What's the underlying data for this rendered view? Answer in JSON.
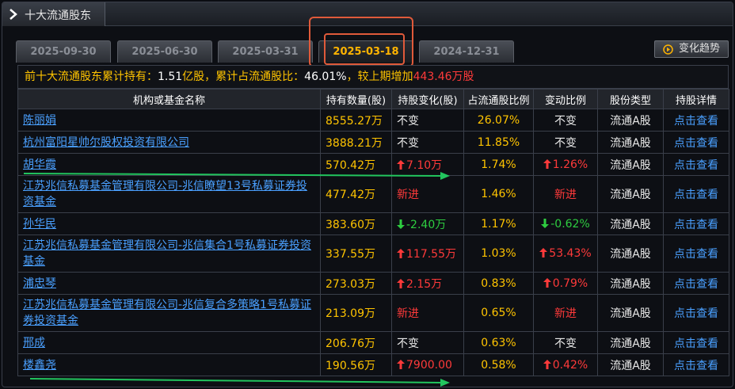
{
  "panel": {
    "title": "十大流通股东"
  },
  "tabs": [
    {
      "label": "2025-09-30",
      "active": false
    },
    {
      "label": "2025-06-30",
      "active": false
    },
    {
      "label": "2025-03-31",
      "active": false
    },
    {
      "label": "2025-03-18",
      "active": true
    },
    {
      "label": "2024-12-31",
      "active": false
    }
  ],
  "trend_button": {
    "label": "变化趋势"
  },
  "summary": {
    "prefix": "前十大流通股东累计持有：",
    "total_holding": "1.51",
    "mid1": "亿股，累计占流通股比：",
    "total_ratio": "46.01%",
    "mid2": "，较上期增加",
    "increase": "443.46万股"
  },
  "table": {
    "headers": [
      "机构或基金名称",
      "持有数量(股)",
      "持股变化(股)",
      "占流通股比例",
      "变动比例",
      "股份类型",
      "持股详情"
    ],
    "rows": [
      {
        "name": "陈丽娟",
        "amount": "8555.27万",
        "change": "不变",
        "change_dir": "same",
        "pct": "26.07%",
        "ratio": "不变",
        "type": "流通A股",
        "detail": "点击查看"
      },
      {
        "name": "杭州富阳星帅尔股权投资有限公司",
        "amount": "3888.21万",
        "change": "不变",
        "change_dir": "same",
        "pct": "11.85%",
        "ratio": "不变",
        "type": "流通A股",
        "detail": "点击查看"
      },
      {
        "name": "胡华霞",
        "amount": "570.42万",
        "change": "7.10万",
        "change_dir": "up",
        "pct": "1.74%",
        "ratio": "1.26%",
        "type": "流通A股",
        "detail": "点击查看"
      },
      {
        "name": "江苏兆信私募基金管理有限公司-兆信瞭望13号私募证券投资基金",
        "amount": "477.42万",
        "change": "新进",
        "change_dir": "new",
        "pct": "1.46%",
        "ratio": "新进",
        "type": "流通A股",
        "detail": "点击查看"
      },
      {
        "name": "孙华民",
        "amount": "383.60万",
        "change": "-2.40万",
        "change_dir": "down",
        "pct": "1.17%",
        "ratio": "-0.62%",
        "type": "流通A股",
        "detail": "点击查看"
      },
      {
        "name": "江苏兆信私募基金管理有限公司-兆信集合1号私募证券投资基金",
        "amount": "337.55万",
        "change": "117.55万",
        "change_dir": "up",
        "pct": "1.03%",
        "ratio": "53.43%",
        "type": "流通A股",
        "detail": "点击查看"
      },
      {
        "name": "浦忠琴",
        "amount": "273.03万",
        "change": "2.15万",
        "change_dir": "up",
        "pct": "0.83%",
        "ratio": "0.79%",
        "type": "流通A股",
        "detail": "点击查看"
      },
      {
        "name": "江苏兆信私募基金管理有限公司-兆信复合多策略1号私募证券投资基金",
        "amount": "213.09万",
        "change": "新进",
        "change_dir": "new",
        "pct": "0.65%",
        "ratio": "新进",
        "type": "流通A股",
        "detail": "点击查看"
      },
      {
        "name": "邢成",
        "amount": "206.76万",
        "change": "不变",
        "change_dir": "same",
        "pct": "0.63%",
        "ratio": "不变",
        "type": "流通A股",
        "detail": "点击查看"
      },
      {
        "name": "楼鑫尧",
        "amount": "190.56万",
        "change": "7900.00",
        "change_dir": "up",
        "pct": "0.58%",
        "ratio": "0.42%",
        "type": "流通A股",
        "detail": "点击查看"
      }
    ]
  },
  "colors": {
    "accent": "#ffb400",
    "up": "#ff3a3a",
    "down": "#2ecc40",
    "link": "#4aa0ff",
    "annotation": "#e05a3a",
    "annotation_arrow": "#22c55e"
  }
}
